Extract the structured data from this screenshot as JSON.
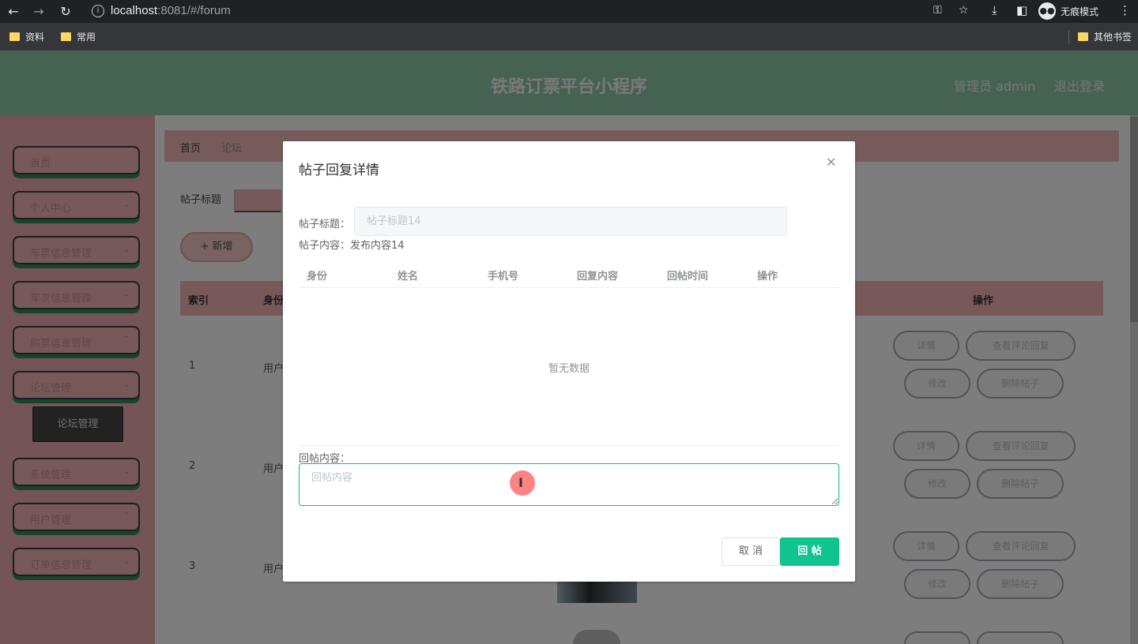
{
  "browser": {
    "url_host": "localhost",
    "url_rest": ":8081/#/forum",
    "incognito_label": "无痕模式",
    "bookmarks": [
      "资料",
      "常用"
    ],
    "other_bookmarks": "其他书签"
  },
  "header": {
    "title": "铁路订票平台小程序",
    "user": "管理员 admin",
    "logout": "退出登录"
  },
  "sidebar": {
    "items": [
      {
        "label": "首页"
      },
      {
        "label": "个人中心"
      },
      {
        "label": "车票信息管理"
      },
      {
        "label": "车次信息管理"
      },
      {
        "label": "购票信息管理"
      },
      {
        "label": "论坛管理"
      },
      {
        "label": "系统管理"
      },
      {
        "label": "用户管理"
      },
      {
        "label": "订单信息管理"
      }
    ],
    "sub_item": "论坛管理"
  },
  "breadcrumb": {
    "home": "首页",
    "current": "论坛"
  },
  "search": {
    "label": "帖子标题"
  },
  "add_button": "+ 新增",
  "table": {
    "headers": {
      "index": "索引",
      "identity": "身份",
      "ops": "操作"
    },
    "rows": [
      {
        "index": "1",
        "identity": "用户"
      },
      {
        "index": "2",
        "identity": "用户"
      },
      {
        "index": "3",
        "identity": "用户"
      }
    ],
    "actions": {
      "detail": "详情",
      "view_reply": "查看评论回复",
      "edit": "修改",
      "delete": "删除帖子"
    }
  },
  "dialog": {
    "title": "帖子回复详情",
    "title_label": "帖子标题：",
    "title_value": "帖子标题14",
    "content_label": "帖子内容：",
    "content_value": "发布内容14",
    "columns": [
      "身份",
      "姓名",
      "手机号",
      "回复内容",
      "回帖时间",
      "操作"
    ],
    "empty_text": "暂无数据",
    "reply_label": "回帖内容：",
    "reply_placeholder": "回帖内容",
    "cancel": "取 消",
    "submit": "回 帖"
  }
}
